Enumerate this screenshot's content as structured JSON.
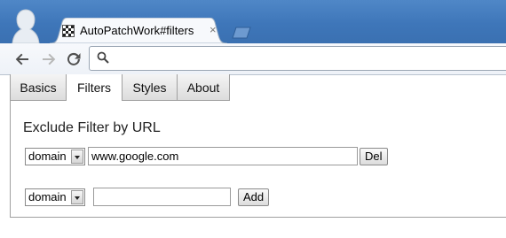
{
  "browser": {
    "tab": {
      "title": "AutoPatchWork#filters",
      "close_glyph": "×"
    },
    "toolbar": {
      "back_icon": "back-arrow-icon",
      "forward_icon": "forward-arrow-icon",
      "reload_icon": "reload-icon",
      "omnibox_value": ""
    }
  },
  "page": {
    "tabs": [
      {
        "label": "Basics",
        "active": false
      },
      {
        "label": "Filters",
        "active": true
      },
      {
        "label": "Styles",
        "active": false
      },
      {
        "label": "About",
        "active": false
      }
    ],
    "section_title": "Exclude Filter by URL",
    "filters": [
      {
        "type": "domain",
        "value": "www.google.com",
        "button": "Del"
      }
    ],
    "new_filter": {
      "type": "domain",
      "value": "",
      "button": "Add"
    }
  },
  "colors": {
    "frame": "#3e76b9",
    "toolbar": "#eef2f8",
    "border": "#a0a0a0"
  }
}
